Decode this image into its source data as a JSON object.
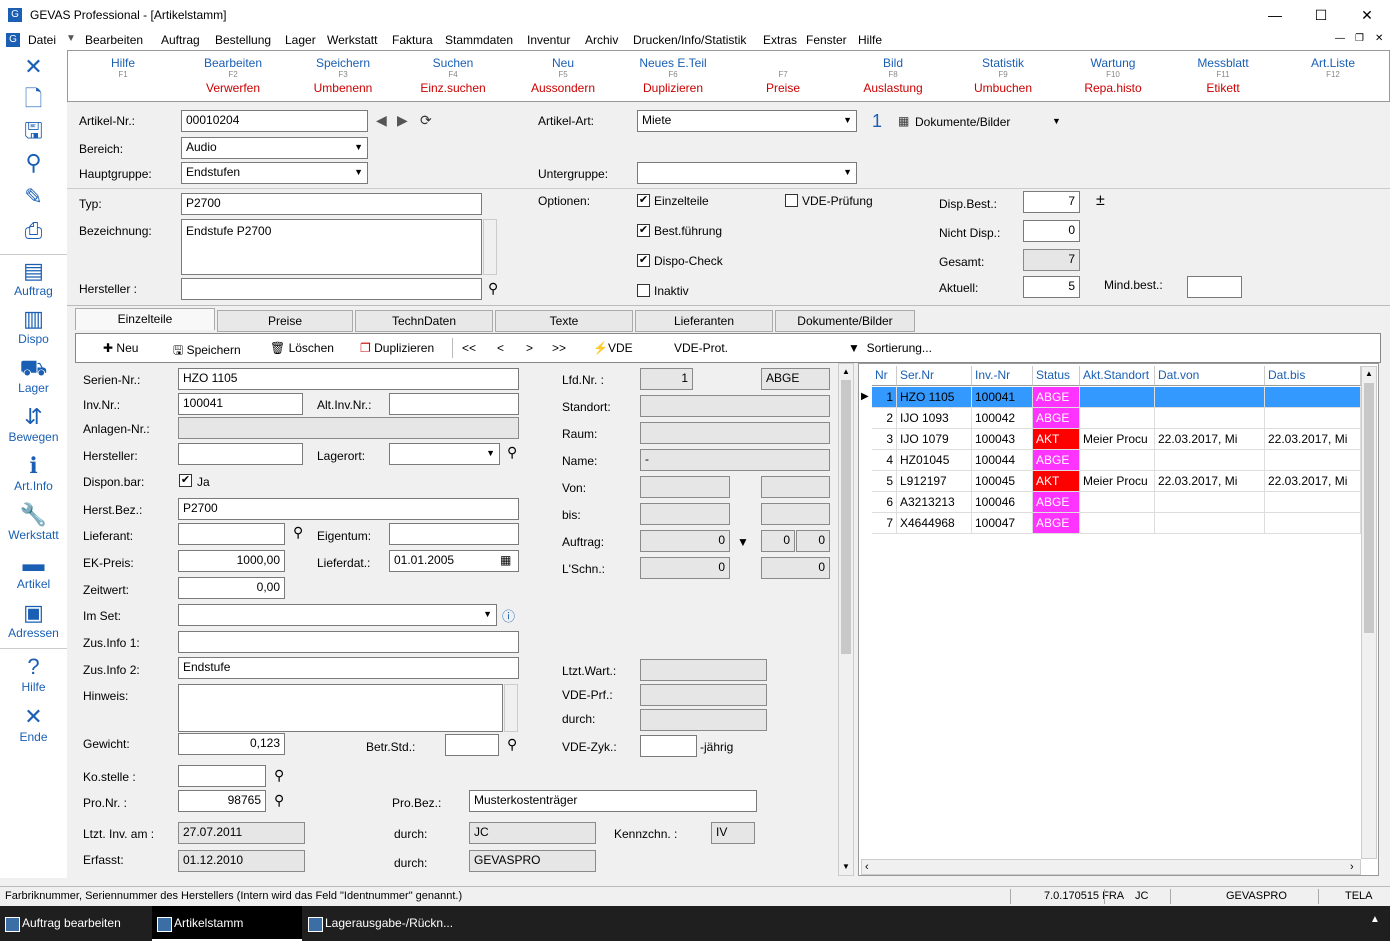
{
  "window": {
    "title": "GEVAS Professional - [Artikelstamm]",
    "minimize": "—",
    "maximize": "☐",
    "close": "✕"
  },
  "menu": {
    "datei": "Datei",
    "bearbeiten": "Bearbeiten",
    "auftrag": "Auftrag",
    "bestellung": "Bestellung",
    "lager": "Lager",
    "werkstatt": "Werkstatt",
    "faktura": "Faktura",
    "stammdaten": "Stammdaten",
    "inventur": "Inventur",
    "archiv": "Archiv",
    "drucken": "Drucken/Info/Statistik",
    "extras": "Extras",
    "fenster": "Fenster",
    "hilfe": "Hilfe"
  },
  "sidebar": {
    "auftrag": "Auftrag",
    "dispo": "Dispo",
    "lager": "Lager",
    "bewegen": "Bewegen",
    "artinfo": "Art.Info",
    "werkstatt": "Werkstatt",
    "artikel": "Artikel",
    "adressen": "Adressen",
    "hilfe": "Hilfe",
    "ende": "Ende"
  },
  "fkeys": [
    {
      "a": "Hilfe",
      "k": "F1",
      "b": ""
    },
    {
      "a": "Bearbeiten",
      "k": "F2",
      "b": "Verwerfen"
    },
    {
      "a": "Speichern",
      "k": "F3",
      "b": "Umbenenn"
    },
    {
      "a": "Suchen",
      "k": "F4",
      "b": "Einz.suchen"
    },
    {
      "a": "Neu",
      "k": "F5",
      "b": "Aussondern"
    },
    {
      "a": "Neues E.Teil",
      "k": "F6",
      "b": "Duplizieren"
    },
    {
      "a": "",
      "k": "F7",
      "b": "Preise"
    },
    {
      "a": "Bild",
      "k": "F8",
      "b": "Auslastung"
    },
    {
      "a": "Statistik",
      "k": "F9",
      "b": "Umbuchen"
    },
    {
      "a": "Wartung",
      "k": "F10",
      "b": "Repa.histo"
    },
    {
      "a": "Messblatt",
      "k": "F11",
      "b": "Etikett"
    },
    {
      "a": "Art.Liste",
      "k": "F12",
      "b": ""
    }
  ],
  "head": {
    "artnr_lbl": "Artikel-Nr.:",
    "artnr": "00010204",
    "bereich_lbl": "Bereich:",
    "bereich": "Audio",
    "haupt_lbl": "Hauptgruppe:",
    "haupt": "Endstufen",
    "artart_lbl": "Artikel-Art:",
    "artart": "Miete",
    "count": "1",
    "dok": "Dokumente/Bilder",
    "unter_lbl": "Untergruppe:",
    "unter": "",
    "typ_lbl": "Typ:",
    "typ": "P2700",
    "bez_lbl": "Bezeichnung:",
    "bez": "Endstufe P2700",
    "herst_lbl": "Hersteller :",
    "herst": "",
    "opt_lbl": "Optionen:",
    "einzelteile": "Einzelteile",
    "bestf": "Best.führung",
    "dispo": "Dispo-Check",
    "inaktiv": "Inaktiv",
    "vde": "VDE-Prüfung",
    "dispbest_lbl": "Disp.Best.:",
    "dispbest": "7",
    "plusminus": "±",
    "nichtdisp_lbl": "Nicht Disp.:",
    "nichtdisp": "0",
    "gesamt_lbl": "Gesamt:",
    "gesamt": "7",
    "aktuell_lbl": "Aktuell:",
    "aktuell": "5",
    "mindbest_lbl": "Mind.best.:",
    "mindbest": ""
  },
  "tabs": [
    "Einzelteile",
    "Preise",
    "TechnDaten",
    "Texte",
    "Lieferanten",
    "Dokumente/Bilder"
  ],
  "toolbar": {
    "neu": "Neu",
    "speichern": "Speichern",
    "loeschen": "Löschen",
    "duplizieren": "Duplizieren",
    "first": "<<",
    "prev": "<",
    "next": ">",
    "last": ">>",
    "vde": "VDE",
    "vdeprot": "VDE-Prot.",
    "sort": "Sortierung..."
  },
  "detail": {
    "sernr_lbl": "Serien-Nr.:",
    "sernr": "HZO 1105",
    "invnr_lbl": "Inv.Nr.:",
    "invnr": "100041",
    "altinv_lbl": "Alt.Inv.Nr.:",
    "altinv": "",
    "anlagen_lbl": "Anlagen-Nr.:",
    "anlagen": "",
    "herst_lbl": "Hersteller:",
    "herst": "",
    "lagerort_lbl": "Lagerort:",
    "lagerort": "",
    "dispon_lbl": "Dispon.bar:",
    "dispon": "Ja",
    "herstbez_lbl": "Herst.Bez.:",
    "herstbez": "P2700",
    "lief_lbl": "Lieferant:",
    "lief": "",
    "eigentum_lbl": "Eigentum:",
    "eigentum": "",
    "ekpreis_lbl": "EK-Preis:",
    "ekpreis": "1000,00",
    "lieferdat_lbl": "Lieferdat.:",
    "lieferdat": "01.01.2005",
    "zeitwert_lbl": "Zeitwert:",
    "zeitwert": "0,00",
    "imset_lbl": "Im Set:",
    "imset": "",
    "zus1_lbl": "Zus.Info 1:",
    "zus1": "",
    "zus2_lbl": "Zus.Info 2:",
    "zus2": "Endstufe",
    "hinweis_lbl": "Hinweis:",
    "hinweis": "",
    "gewicht_lbl": "Gewicht:",
    "gewicht": "0,123",
    "betr_lbl": "Betr.Std.:",
    "betr": "",
    "kostelle_lbl": "Ko.stelle :",
    "kostelle": "",
    "pronr_lbl": "Pro.Nr. :",
    "pronr": "98765",
    "probez_lbl": "Pro.Bez.:",
    "probez": "Musterkostenträger",
    "ltztinv_lbl": "Ltzt. Inv. am :",
    "ltztinv": "27.07.2011",
    "durch1_lbl": "durch:",
    "durch1": "JC",
    "kennz_lbl": "Kennzchn. :",
    "kennz": "IV",
    "erfasst_lbl": "Erfasst:",
    "erfasst": "01.12.2010",
    "durch2_lbl": "durch:",
    "durch2": "GEVASPRO",
    "lfdnr_lbl": "Lfd.Nr. :",
    "lfdnr": "1",
    "lfdstatus": "ABGE",
    "standort_lbl": "Standort:",
    "raum_lbl": "Raum:",
    "name_lbl": "Name:",
    "name": "-",
    "von_lbl": "Von:",
    "bis_lbl": "bis:",
    "auftrag_lbl": "Auftrag:",
    "auftrag": "0",
    "auftrag2": "0",
    "auftrag3": "0",
    "lschn_lbl": "L'Schn.:",
    "lschn": "0",
    "lschn2": "0",
    "ltztwart_lbl": "Ltzt.Wart.:",
    "vdeprf_lbl": "VDE-Prf.:",
    "durch3_lbl": "durch:",
    "vdezyk_lbl": "VDE-Zyk.:",
    "jaehrig": "-jährig"
  },
  "grid": {
    "headers": [
      "Nr",
      "Ser.Nr",
      "Inv.-Nr",
      "Status",
      "Akt.Standort",
      "Dat.von",
      "Dat.bis"
    ],
    "rows": [
      {
        "nr": "1",
        "ser": "HZO 1105",
        "inv": "100041",
        "status": "ABGE",
        "ort": "",
        "von": "",
        "bis": ""
      },
      {
        "nr": "2",
        "ser": "IJO 1093",
        "inv": "100042",
        "status": "ABGE",
        "ort": "",
        "von": "",
        "bis": ""
      },
      {
        "nr": "3",
        "ser": "IJO 1079",
        "inv": "100043",
        "status": "AKT",
        "ort": "Meier Procu",
        "von": "22.03.2017, Mi",
        "bis": "22.03.2017, Mi"
      },
      {
        "nr": "4",
        "ser": "HZ01045",
        "inv": "100044",
        "status": "ABGE",
        "ort": "",
        "von": "",
        "bis": ""
      },
      {
        "nr": "5",
        "ser": "L912197",
        "inv": "100045",
        "status": "AKT",
        "ort": "Meier Procu",
        "von": "22.03.2017, Mi",
        "bis": "22.03.2017, Mi"
      },
      {
        "nr": "6",
        "ser": "A3213213",
        "inv": "100046",
        "status": "ABGE",
        "ort": "",
        "von": "",
        "bis": ""
      },
      {
        "nr": "7",
        "ser": "X4644968",
        "inv": "100047",
        "status": "ABGE",
        "ort": "",
        "von": "",
        "bis": ""
      }
    ]
  },
  "status": {
    "msg": "Farbriknummer, Seriennummer des Herstellers (Intern wird das Feld \"Identnummer\" genannt.)",
    "ver": "7.0.170515 FRA",
    "user": "JC",
    "db": "GEVASPRO",
    "tela": "TELA"
  },
  "taskbar": [
    "Auftrag bearbeiten",
    "Artikelstamm",
    "Lagerausgabe-/Rückn..."
  ],
  "colors": {
    "abge": "#ff33ff",
    "akt": "#ff0000",
    "selected": "#3399ff",
    "accent": "#1a5fb4"
  }
}
